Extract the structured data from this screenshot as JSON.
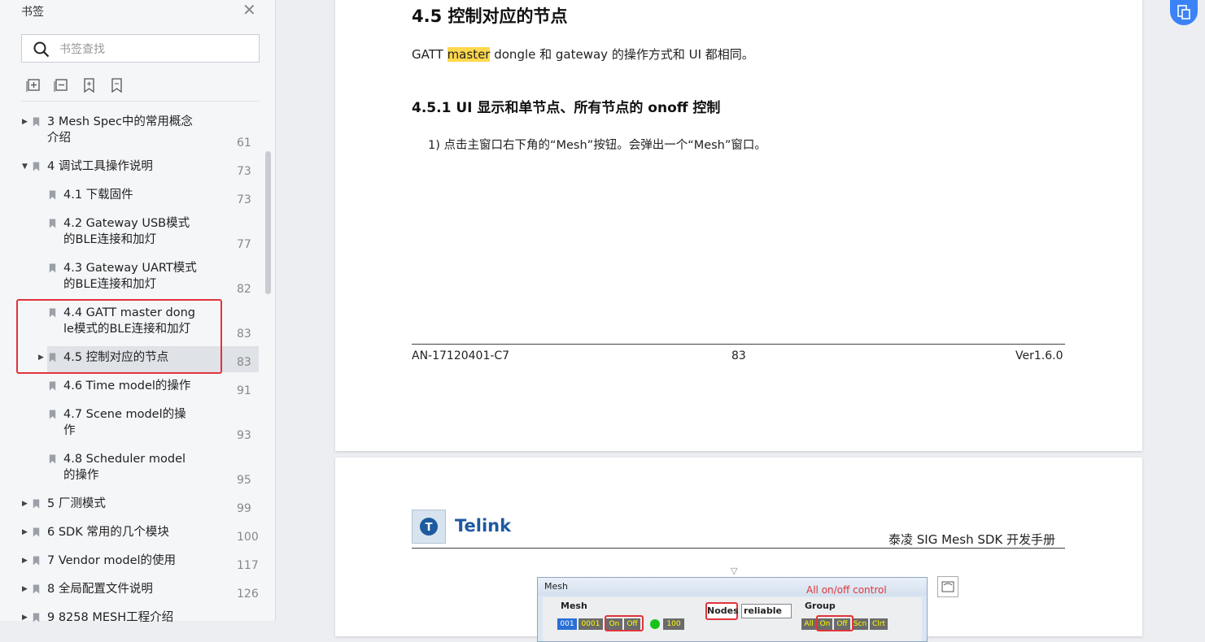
{
  "sidebar": {
    "title": "书签",
    "search_placeholder": "书签查找",
    "tree": [
      {
        "label_lines": [
          "3 Mesh Spec中的常用概念",
          "介绍"
        ],
        "page": "61",
        "level": 0,
        "arrow": "right"
      },
      {
        "label_lines": [
          "4 调试工具操作说明"
        ],
        "page": "73",
        "level": 0,
        "arrow": "down"
      },
      {
        "label_lines": [
          "4.1 下载固件"
        ],
        "page": "73",
        "level": 1,
        "arrow": ""
      },
      {
        "label_lines": [
          "4.2 Gateway USB模式",
          "的BLE连接和加灯"
        ],
        "page": "77",
        "level": 1,
        "arrow": ""
      },
      {
        "label_lines": [
          "4.3 Gateway UART模式",
          "的BLE连接和加灯"
        ],
        "page": "82",
        "level": 1,
        "arrow": ""
      },
      {
        "label_lines": [
          "4.4 GATT master dong",
          "le模式的BLE连接和加灯"
        ],
        "page": "83",
        "level": 1,
        "arrow": ""
      },
      {
        "label_lines": [
          "4.5 控制对应的节点"
        ],
        "page": "83",
        "level": 1,
        "arrow": "right",
        "selected": true
      },
      {
        "label_lines": [
          "4.6 Time model的操作"
        ],
        "page": "91",
        "level": 1,
        "arrow": ""
      },
      {
        "label_lines": [
          "4.7 Scene model的操",
          "作"
        ],
        "page": "93",
        "level": 1,
        "arrow": ""
      },
      {
        "label_lines": [
          "4.8 Scheduler model",
          "的操作"
        ],
        "page": "95",
        "level": 1,
        "arrow": ""
      },
      {
        "label_lines": [
          "5 厂测模式"
        ],
        "page": "99",
        "level": 0,
        "arrow": "right"
      },
      {
        "label_lines": [
          "6 SDK 常用的几个模块"
        ],
        "page": "100",
        "level": 0,
        "arrow": "right"
      },
      {
        "label_lines": [
          "7 Vendor model的使用"
        ],
        "page": "117",
        "level": 0,
        "arrow": "right"
      },
      {
        "label_lines": [
          "8 全局配置文件说明"
        ],
        "page": "126",
        "level": 0,
        "arrow": "right"
      },
      {
        "label_lines": [
          "9 8258 MESH工程介绍"
        ],
        "page": "",
        "level": 0,
        "arrow": "right"
      }
    ]
  },
  "document": {
    "page1": {
      "heading": "4.5  控制对应的节点",
      "para_before": "GATT ",
      "para_highlight": "master",
      "para_after": " dongle 和 gateway 的操作方式和 UI 都相同。",
      "subheading": "4.5.1  UI 显示和单节点、所有节点的 onoff 控制",
      "step": "1)  点击主窗口右下角的“Mesh”按钮。会弹出一个“Mesh”窗口。",
      "footer_left": "AN-17120401-C7",
      "footer_center": "83",
      "footer_right": "Ver1.6.0"
    },
    "page2": {
      "logo_text": "Telink",
      "logo_mark": "T",
      "header_title": "泰凌 SIG Mesh SDK 开发手册",
      "figure": {
        "window_title": "Mesh",
        "note": "All on/off control",
        "group_mesh": "Mesh",
        "group_group": "Group",
        "nodes_button": "Nodes",
        "reliable_select": "reliable",
        "cells_left": [
          "001",
          "0001",
          "On",
          "Off",
          "100"
        ],
        "cells_right": [
          "All",
          "On",
          "Off",
          "Scn",
          "Clrt"
        ]
      }
    }
  },
  "colors": {
    "accent_blue": "#3b82f6",
    "highlight_red": "#e0343a",
    "search_highlight": "#ffd84d"
  }
}
